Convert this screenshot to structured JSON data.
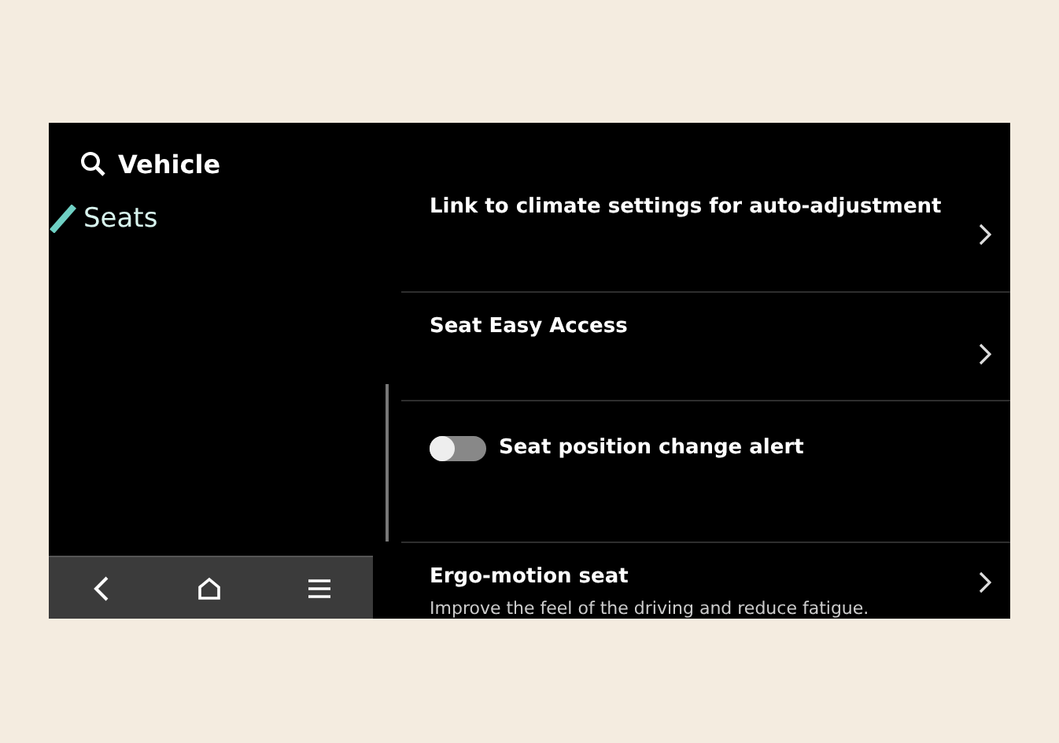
{
  "header": {
    "title": "Vehicle"
  },
  "sidebar": {
    "items": [
      {
        "label": "Seats",
        "selected": true
      }
    ]
  },
  "nav_bar": {
    "buttons": [
      {
        "kind": "back"
      },
      {
        "kind": "home"
      },
      {
        "kind": "menu"
      }
    ]
  },
  "settings": [
    {
      "kind": "link",
      "title": "Link to climate settings for auto-adjustment"
    },
    {
      "kind": "link",
      "title": "Seat Easy Access"
    },
    {
      "kind": "toggle",
      "title": "Seat position change alert",
      "on": false
    },
    {
      "kind": "link",
      "title": "Ergo-motion seat",
      "subtitle": "Improve the feel of the driving and reduce fatigue."
    }
  ]
}
